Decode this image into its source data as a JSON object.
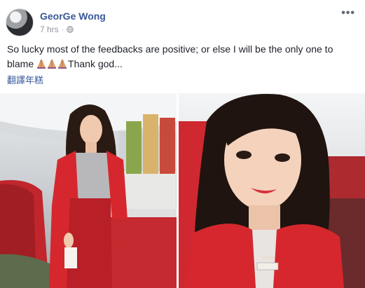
{
  "post": {
    "author": "GeorGe Wong",
    "time": "7 hrs",
    "dot": "·",
    "more": "•••",
    "text_line1": "So lucky most of the feedbacks are positive; or else I will be the only one to",
    "text_line2_start": "blame",
    "text_line2_end": "Thank god...",
    "translate_link": "翻譯年糕"
  },
  "icons": [
    "avatar",
    "globe-icon",
    "more-options-icon",
    "pray-emoji-icon"
  ],
  "colors": {
    "author_link": "#385898",
    "meta_gray": "#90949c",
    "uniform_red": "#d6272e"
  },
  "photos": [
    {
      "id": "photo-flight-attendant-cabin"
    },
    {
      "id": "photo-flight-attendant-selfie"
    }
  ]
}
